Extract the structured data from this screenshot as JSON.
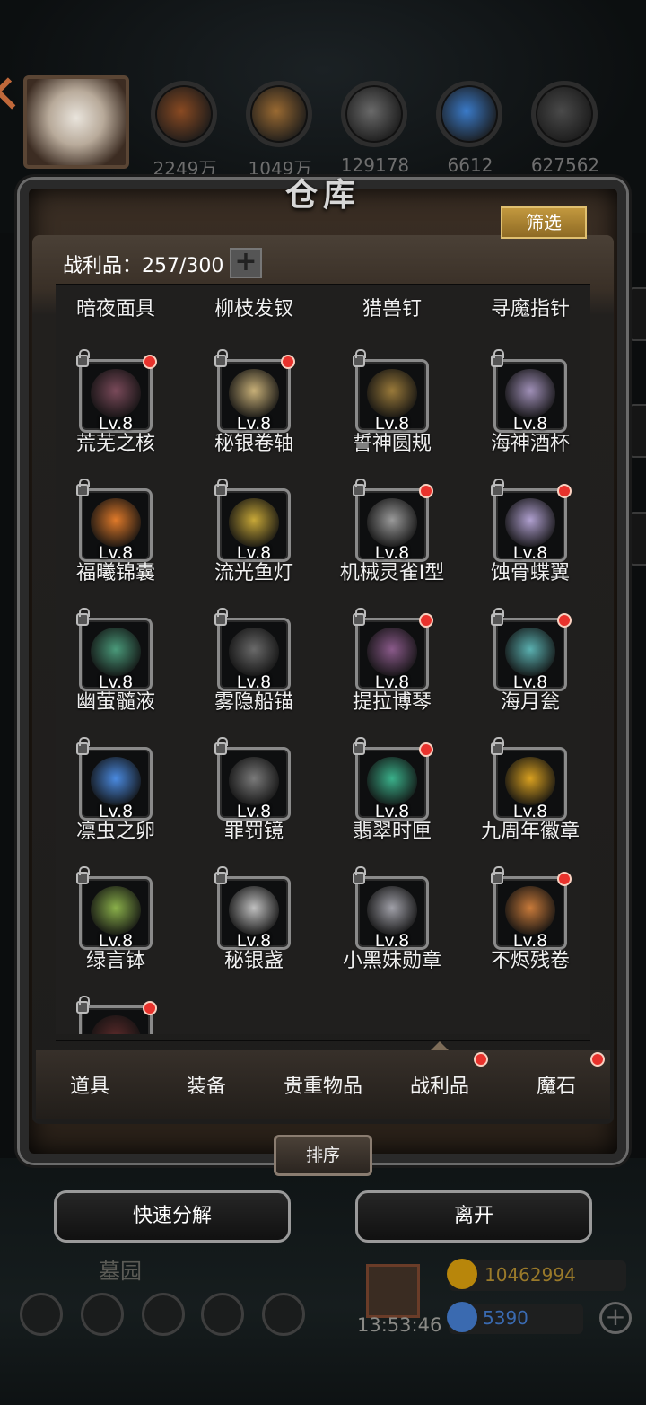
{
  "header": {
    "resources": [
      {
        "name": "bread-resource",
        "value": "2249万",
        "color": "#8a4a22"
      },
      {
        "name": "wood-resource",
        "value": "1049万",
        "color": "#9a6a32"
      },
      {
        "name": "iron-resource",
        "value": "129178",
        "color": "#6a6a6a"
      },
      {
        "name": "crystal-resource",
        "value": "6612",
        "color": "#3a7ac8"
      },
      {
        "name": "steel-resource",
        "value": "627562",
        "color": "#4a4a4a"
      }
    ]
  },
  "panel": {
    "title": "仓库",
    "filter_label": "筛选",
    "count_label": "战利品：257/300",
    "plus_label": "+"
  },
  "partial_row_labels": [
    "暗夜面具",
    "柳枝发钗",
    "猎兽钉",
    "寻魔指针"
  ],
  "items": [
    {
      "name": "荒芜之核",
      "level": "Lv.8",
      "new": true,
      "color": "#7a4a5a"
    },
    {
      "name": "秘银卷轴",
      "level": "Lv.8",
      "new": true,
      "color": "#c8b078"
    },
    {
      "name": "誓神圆规",
      "level": "Lv.8",
      "new": false,
      "color": "#9a7a3a"
    },
    {
      "name": "海神酒杯",
      "level": "Lv.8",
      "new": false,
      "color": "#a090b8"
    },
    {
      "name": "福曦锦囊",
      "level": "Lv.8",
      "new": false,
      "color": "#e07a2a"
    },
    {
      "name": "流光鱼灯",
      "level": "Lv.8",
      "new": false,
      "color": "#c8a838"
    },
    {
      "name": "机械灵雀I型",
      "level": "Lv.8",
      "new": true,
      "color": "#9a9a9a"
    },
    {
      "name": "蚀骨蝶翼",
      "level": "Lv.8",
      "new": true,
      "color": "#b0a0d0"
    },
    {
      "name": "幽萤髓液",
      "level": "Lv.8",
      "new": false,
      "color": "#4a9a7a"
    },
    {
      "name": "雾隐船锚",
      "level": "Lv.8",
      "new": false,
      "color": "#6a6a6a"
    },
    {
      "name": "提拉博琴",
      "level": "Lv.8",
      "new": true,
      "color": "#8a5a8a"
    },
    {
      "name": "海月瓮",
      "level": "Lv.8",
      "new": true,
      "color": "#5ab0b0"
    },
    {
      "name": "凛虫之卵",
      "level": "Lv.8",
      "new": false,
      "color": "#4a8ae0"
    },
    {
      "name": "罪罚镜",
      "level": "Lv.8",
      "new": false,
      "color": "#7a7a7a"
    },
    {
      "name": "翡翠时匣",
      "level": "Lv.8",
      "new": true,
      "color": "#3ab08a"
    },
    {
      "name": "九周年徽章",
      "level": "Lv.8",
      "new": false,
      "color": "#d8a020"
    },
    {
      "name": "绿言钵",
      "level": "Lv.8",
      "new": false,
      "color": "#8ab04a"
    },
    {
      "name": "秘银盏",
      "level": "Lv.8",
      "new": false,
      "color": "#c0c0c0"
    },
    {
      "name": "小黑妹勋章",
      "level": "Lv.8",
      "new": false,
      "color": "#a0a0a8"
    },
    {
      "name": "不烬残卷",
      "level": "Lv.8",
      "new": true,
      "color": "#c87a3a"
    },
    {
      "name": "",
      "level": "",
      "new": true,
      "color": "#5a2a2a"
    }
  ],
  "tabs": [
    {
      "label": "道具",
      "dot": false
    },
    {
      "label": "装备",
      "dot": false
    },
    {
      "label": "贵重物品",
      "dot": false
    },
    {
      "label": "战利品",
      "dot": true,
      "active": true
    },
    {
      "label": "魔石",
      "dot": true
    }
  ],
  "actions": {
    "sort_label": "排序",
    "decompose_label": "快速分解",
    "leave_label": "离开"
  },
  "hud": {
    "location": "墓园",
    "timer": "13:53:46",
    "gold": "10462994",
    "gems": "5390",
    "gold_color": "#b8860b",
    "gem_color": "#3a6ab0"
  }
}
